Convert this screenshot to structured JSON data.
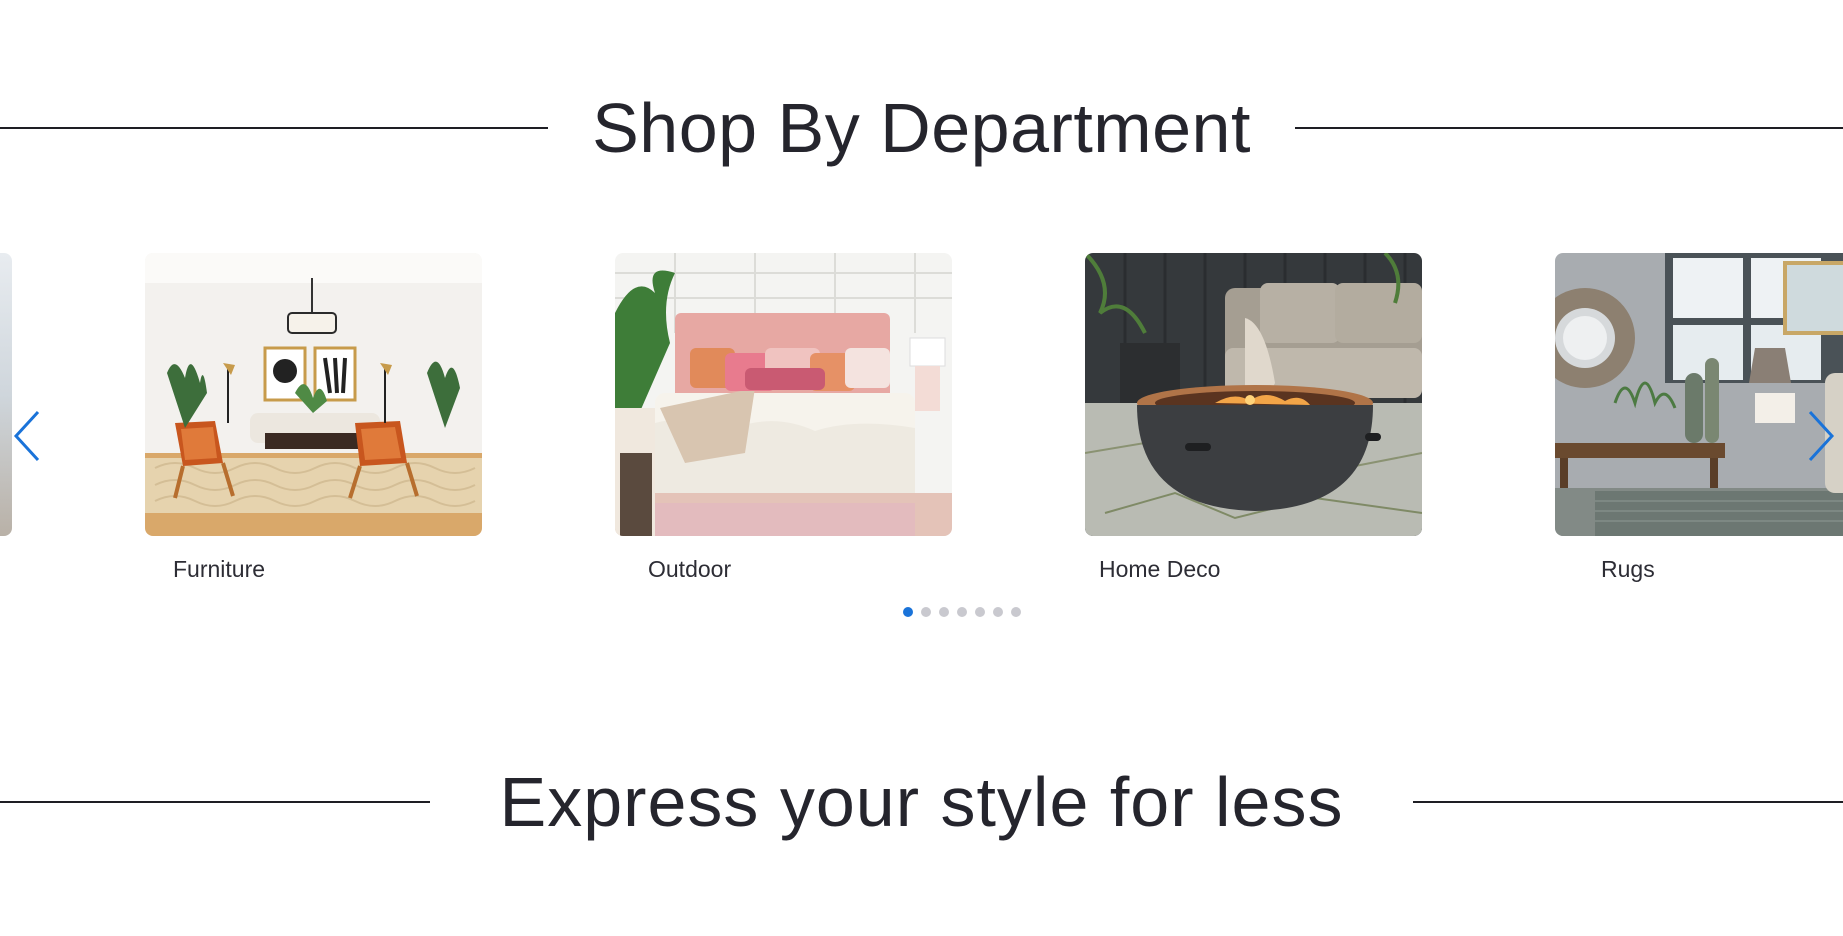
{
  "sections": {
    "department_title": "Shop By Department",
    "express_title": "Express your style for less"
  },
  "carousel": {
    "cards": [
      {
        "label": "Furniture",
        "image": "living-room-furniture"
      },
      {
        "label": "Outdoor",
        "image": "bedroom-outdoor"
      },
      {
        "label": "Home Deco",
        "image": "fire-pit-patio"
      },
      {
        "label": "Rugs",
        "image": "rugs-entryway"
      }
    ],
    "prev_icon": "chevron-left-icon",
    "next_icon": "chevron-right-icon",
    "dots_count": 7,
    "active_dot": 1,
    "accent_color": "#1a73d9"
  }
}
